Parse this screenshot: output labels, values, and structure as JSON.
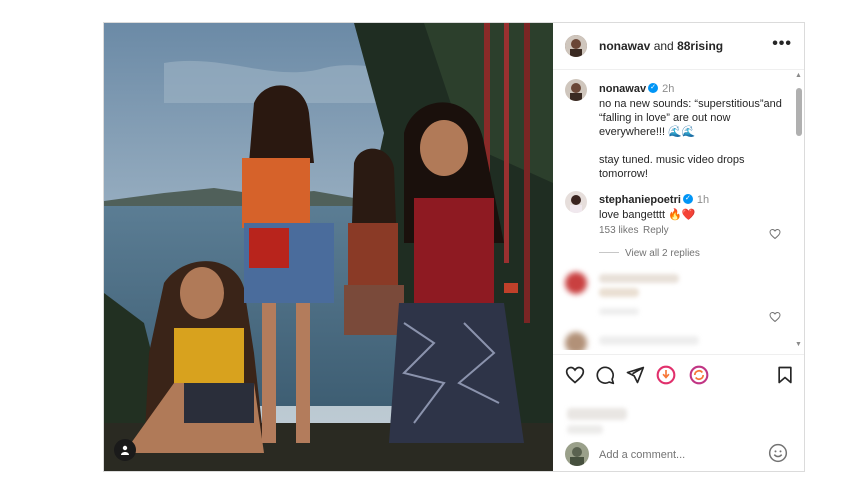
{
  "post": {
    "header": {
      "account": "nonawav",
      "joiner": "and",
      "collaborator": "88rising",
      "more_label": "•••"
    },
    "caption": {
      "username": "nonawav",
      "time": "2h",
      "lines": [
        "no na new sounds: “superstitious”and",
        "“falling in love” are out now",
        "everywhere!!! 🌊🌊",
        "",
        "stay tuned. music video drops",
        "tomorrow!"
      ]
    },
    "comment1": {
      "username": "stephaniepoetri",
      "time": "1h",
      "text": "love bangetttt 🔥❤️",
      "likes": "153 likes",
      "reply": "Reply",
      "view_replies": "View all 2 replies"
    },
    "add_comment_placeholder": "Add a comment..."
  },
  "icons": [
    "user-tag-icon",
    "more-icon",
    "verified-icon",
    "heart-icon",
    "comment-icon",
    "share-icon",
    "audio-icon",
    "remix-icon",
    "save-icon",
    "emoji-icon"
  ],
  "colors": {
    "verified": "#0095f6",
    "border": "#dbdbdb",
    "text": "#262626",
    "secondary": "#737373"
  }
}
